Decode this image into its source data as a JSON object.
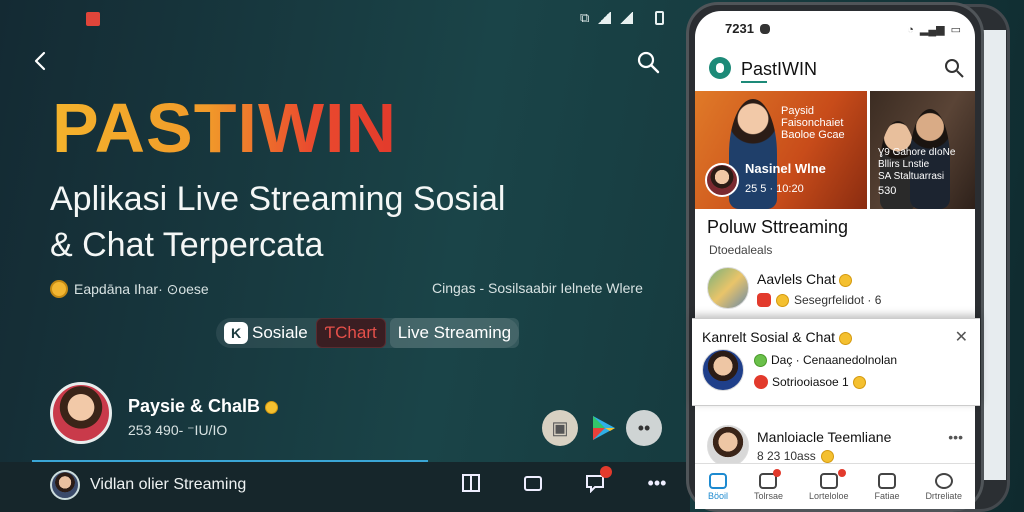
{
  "status_bar": {
    "time_phone": "7231"
  },
  "hero": {
    "brand": "PASTIWIN",
    "tagline_line1": "Aplikasi Live Streaming Sosial",
    "tagline_line2": "& Chat Terpercata",
    "meta_left": "Eapdāna Ihar· ⊙oese",
    "meta_right": "Cingas - Sosilsaabir Ielnete Wlere"
  },
  "chips": {
    "social": "Sosiale",
    "chat": "ƬChart",
    "live": "Live Streaming"
  },
  "profile": {
    "name": "Paysie & ChalB",
    "sub": "253 490- ⁻IU/IO"
  },
  "bottom_bar": {
    "label": "Vidlan olier Streaming"
  },
  "phone": {
    "app_title": "PastIWIN",
    "featured": [
      {
        "tag": "Paysid\nFaisonchaiet\nBaoloe Gcae",
        "name": "Nasinel Wlne",
        "meta": "25 5 · 10:20"
      },
      {
        "tag": "Ɣ9 Gahore dIoNe\nBllirs Lnstie\nSA Staltuarrasi",
        "meta": "530"
      }
    ],
    "section_title": "Poluw Sttreaming",
    "section_sub": "Dtoedaleals",
    "rows": [
      {
        "title": "Aavlels Chat",
        "sub": "Sesegrfelidot  ·  6"
      },
      {
        "title": "Kanrelt Sosial & Chat",
        "sub": "Daç  ·  Cenaanedolnolan",
        "sub2": "Sotriooiasoe  1"
      },
      {
        "title": "Manloiacle Teemliane",
        "sub": "8 23 10ass"
      }
    ],
    "tabs": [
      "Böoil",
      "Tolrsae",
      "Lorteloloe",
      "Fatiae",
      "Drtreliate"
    ]
  },
  "colors": {
    "accent": "#1d8a78",
    "brand_gradient_start": "#f4b32c",
    "brand_gradient_end": "#e23a2c",
    "notification": "#e23a2c",
    "active_tab": "#1d8ad0"
  }
}
